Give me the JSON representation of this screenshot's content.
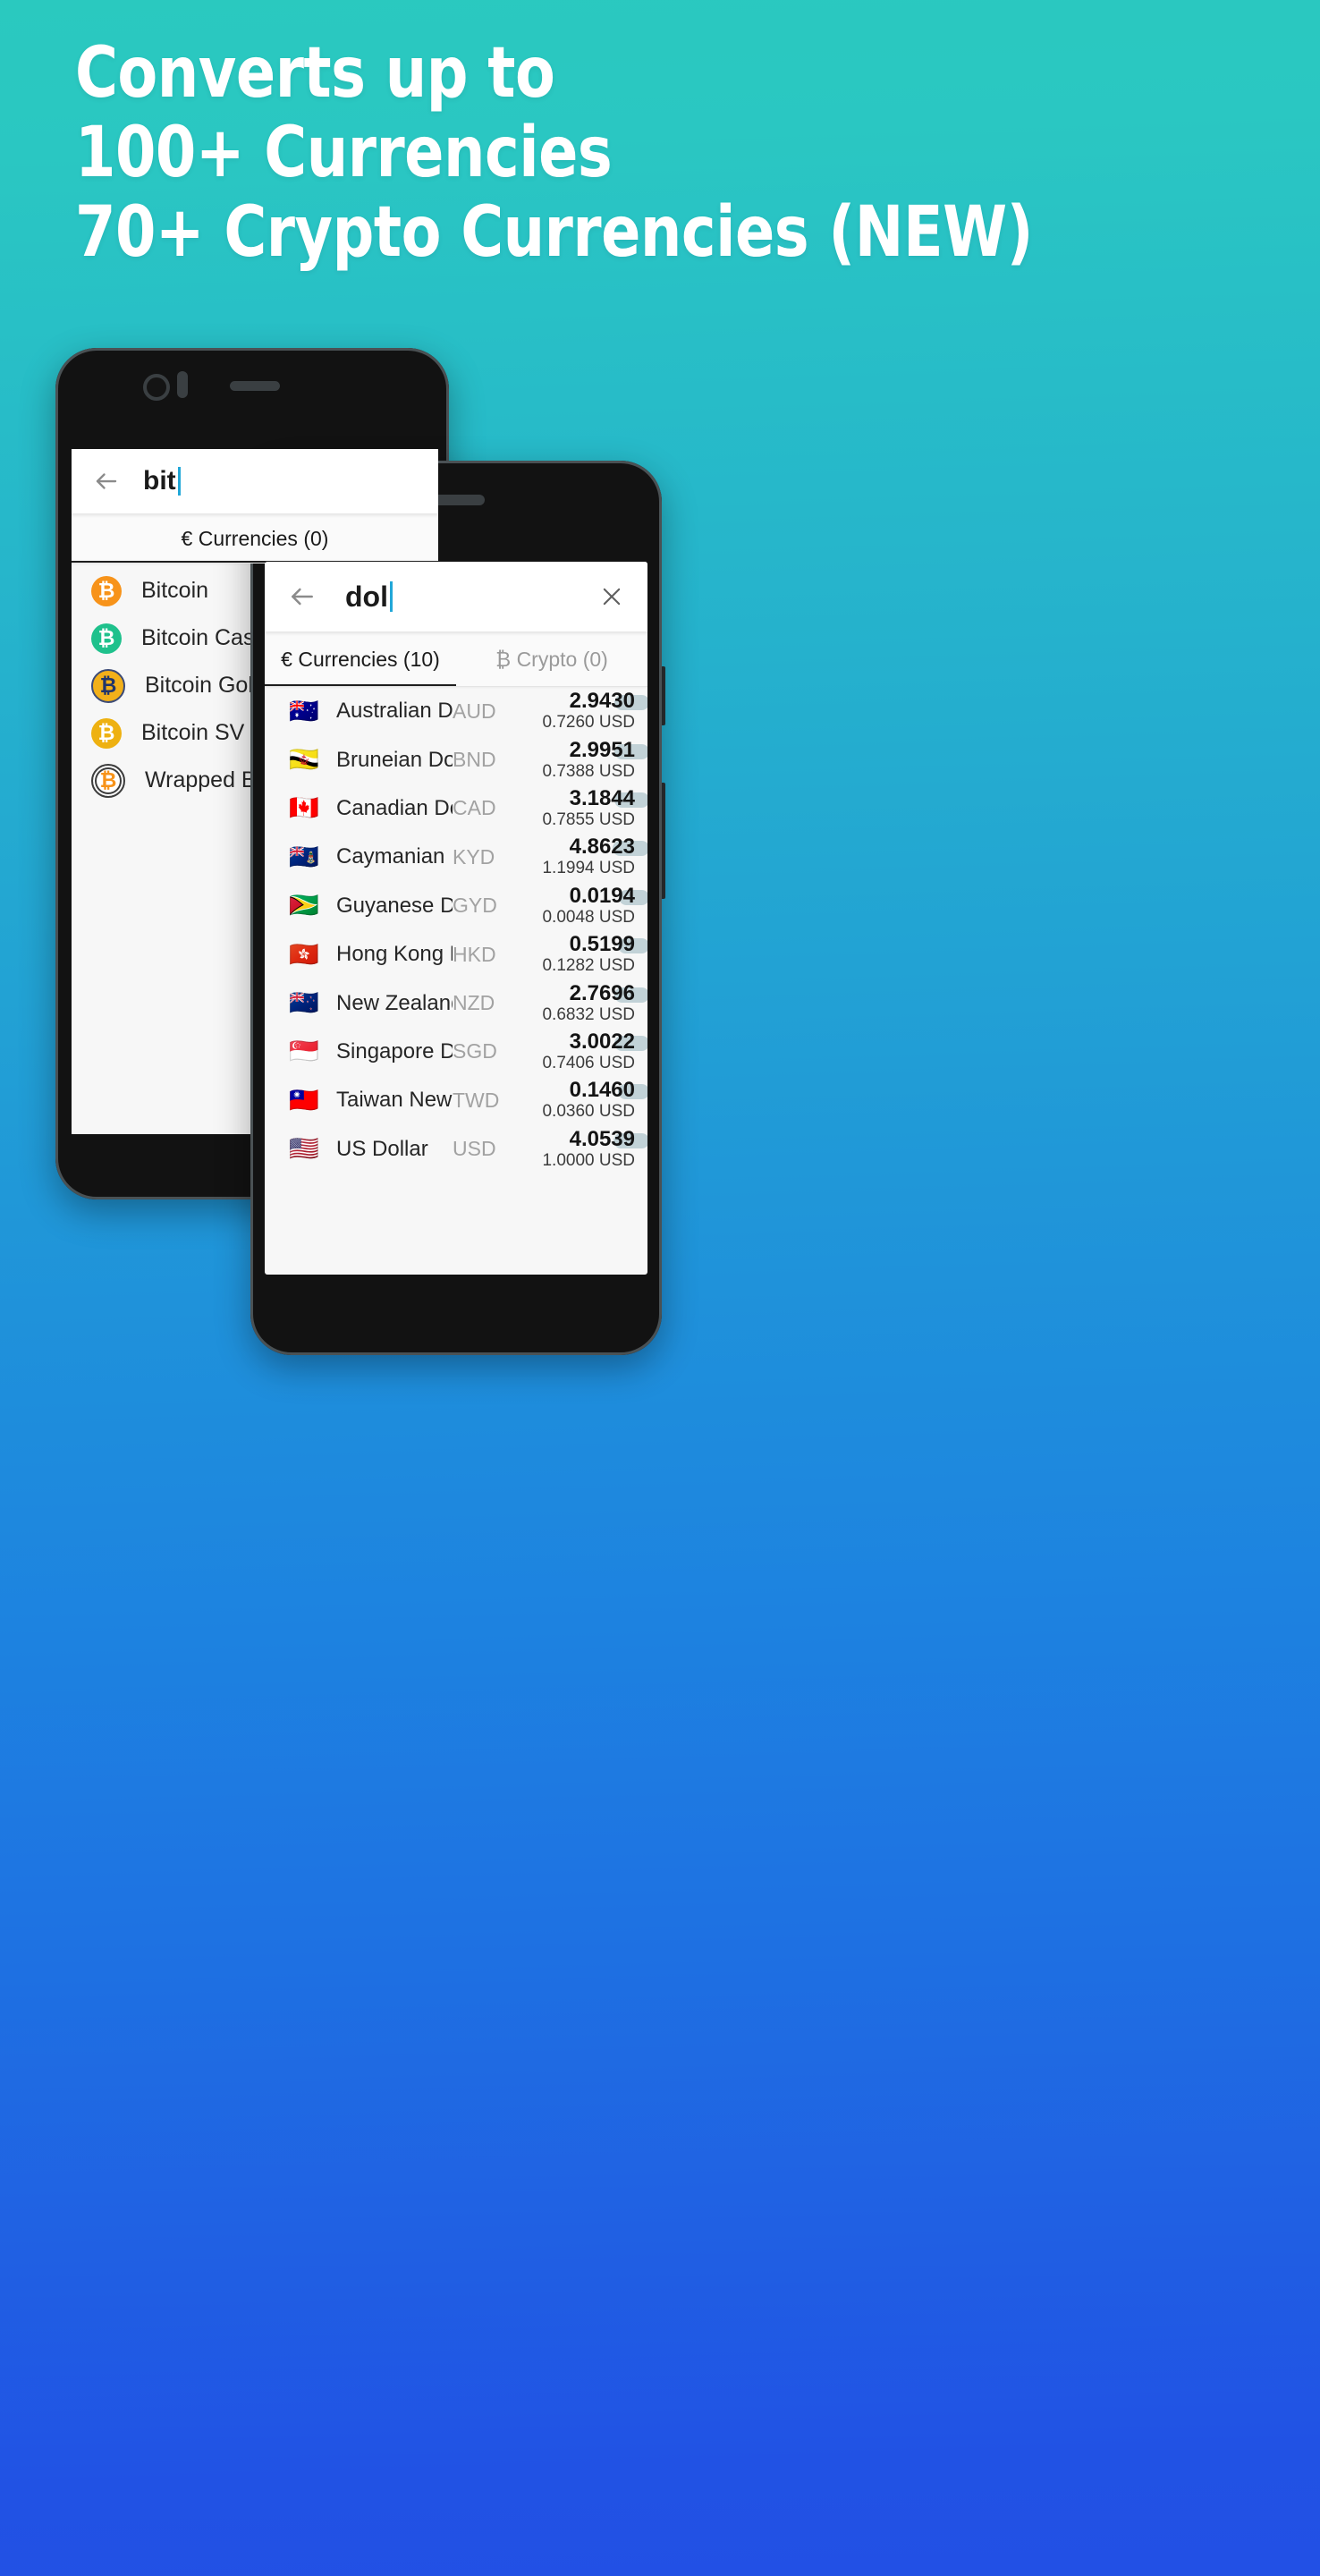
{
  "background": {
    "top_color": "#2ac9bf",
    "bottom_color": "#2250e5"
  },
  "headline": {
    "line1": "Converts up to",
    "line2": "100+ Currencies",
    "line3": "70+ Crypto Currencies (NEW)"
  },
  "back_phone": {
    "search": {
      "value": "bit",
      "back_icon": "arrow-left-icon"
    },
    "tabs": [
      {
        "icon": "euro-symbol",
        "label": "€ Currencies (0)",
        "active": true
      }
    ],
    "crypto_list": [
      {
        "name": "Bitcoin",
        "symbol": "₿",
        "color": "#f7931a",
        "style": "solid"
      },
      {
        "name": "Bitcoin Cash",
        "symbol": "₿",
        "color": "#1fc18c",
        "style": "solid"
      },
      {
        "name": "Bitcoin Gold",
        "symbol": "₿",
        "color": "#f2b01a",
        "style": "gold"
      },
      {
        "name": "Bitcoin SV",
        "symbol": "₿",
        "color": "#eeb111",
        "style": "solid"
      },
      {
        "name": "Wrapped Bitcoin",
        "symbol": "₿",
        "color": "#f7931a",
        "style": "wrapped"
      }
    ]
  },
  "front_phone": {
    "search": {
      "value": "dol",
      "back_icon": "arrow-left-icon",
      "clear_icon": "close-icon"
    },
    "tabs": [
      {
        "label": "€ Currencies (10)",
        "active": true
      },
      {
        "label": "₿ Crypto (0)",
        "active": false
      }
    ],
    "currency_rows": [
      {
        "flag": "🇦🇺",
        "name": "Australian Dollar",
        "code": "AUD",
        "rate": "2.9430",
        "usd": "0.7260 USD",
        "bar": 0.62
      },
      {
        "flag": "🇧🇳",
        "name": "Bruneian Dollar",
        "code": "BND",
        "rate": "2.9951",
        "usd": "0.7388 USD",
        "bar": 0.63
      },
      {
        "flag": "🇨🇦",
        "name": "Canadian Dollar",
        "code": "CAD",
        "rate": "3.1844",
        "usd": "0.7855 USD",
        "bar": 0.68
      },
      {
        "flag": "🇰🇾",
        "name": "Caymanian Dollar",
        "code": "KYD",
        "rate": "4.8623",
        "usd": "1.1994 USD",
        "bar": 0.92
      },
      {
        "flag": "🇬🇾",
        "name": "Guyanese Dollar",
        "code": "GYD",
        "rate": "0.0194",
        "usd": "0.0048 USD",
        "bar": 0.05
      },
      {
        "flag": "🇭🇰",
        "name": "Hong Kong Dollar",
        "code": "HKD",
        "rate": "0.5199",
        "usd": "0.1282 USD",
        "bar": 0.14
      },
      {
        "flag": "🇳🇿",
        "name": "New Zealand Dollar",
        "code": "NZD",
        "rate": "2.7696",
        "usd": "0.6832 USD",
        "bar": 0.58
      },
      {
        "flag": "🇸🇬",
        "name": "Singapore Dollar",
        "code": "SGD",
        "rate": "3.0022",
        "usd": "0.7406 USD",
        "bar": 0.64
      },
      {
        "flag": "🇹🇼",
        "name": "Taiwan New Dollar",
        "code": "TWD",
        "rate": "0.1460",
        "usd": "0.0360 USD",
        "bar": 0.08
      },
      {
        "flag": "🇺🇸",
        "name": "US Dollar",
        "code": "USD",
        "rate": "4.0539",
        "usd": "1.0000 USD",
        "bar": 0.8
      }
    ]
  }
}
